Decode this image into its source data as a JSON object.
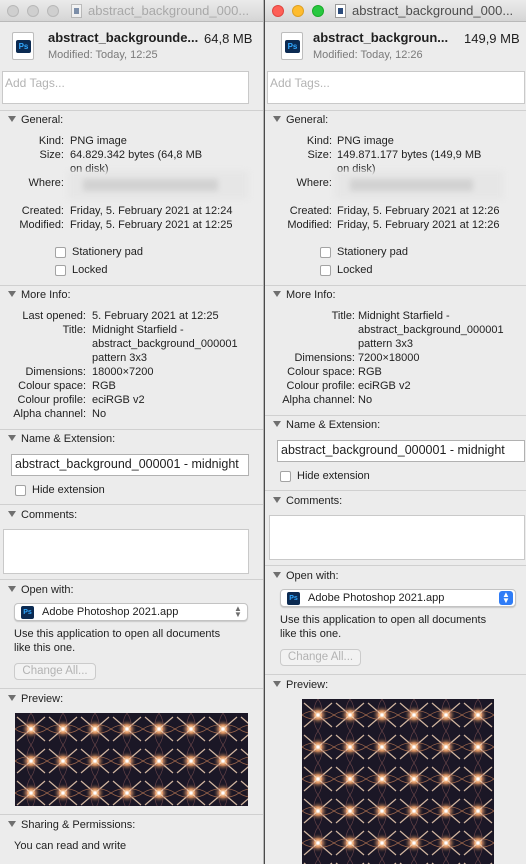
{
  "left_window": {
    "title": "abstract_background_000...",
    "file_name": "abstract_backgrounde...",
    "size_short": "64,8 MB",
    "modified_header": "Modified: Today, 12:25",
    "tags_placeholder": "Add Tags...",
    "general": {
      "header": "General:",
      "kind_label": "Kind:",
      "kind": "PNG image",
      "size_label": "Size:",
      "size_line1": "64.829.342 bytes (64,8 MB",
      "size_line2": "on disk)",
      "where_label": "Where:",
      "created_label": "Created:",
      "created": "Friday, 5. February 2021 at 12:24",
      "modified_label": "Modified:",
      "modified": "Friday, 5. February 2021 at 12:25",
      "stationery": "Stationery pad",
      "locked": "Locked"
    },
    "more_info": {
      "header": "More Info:",
      "last_opened_label": "Last opened:",
      "last_opened": "5. February 2021 at 12:25",
      "title_label": "Title:",
      "title_line1": "Midnight Starfield -",
      "title_line2": "abstract_background_000001",
      "title_line3": "pattern 3x3",
      "dimensions_label": "Dimensions:",
      "dimensions": "18000×7200",
      "colour_space_label": "Colour space:",
      "colour_space": "RGB",
      "colour_profile_label": "Colour profile:",
      "colour_profile": "eciRGB v2",
      "alpha_label": "Alpha channel:",
      "alpha": "No"
    },
    "name_ext": {
      "header": "Name & Extension:",
      "value": "abstract_background_000001 - midnight",
      "hide_ext": "Hide extension"
    },
    "comments_header": "Comments:",
    "open_with": {
      "header": "Open with:",
      "app": "Adobe Photoshop 2021.app",
      "desc_line1": "Use this application to open all documents",
      "desc_line2": "like this one.",
      "change_all": "Change All..."
    },
    "preview_header": "Preview:",
    "sharing": {
      "header": "Sharing & Permissions:",
      "text": "You can read and write"
    }
  },
  "right_window": {
    "title": "abstract_background_000...",
    "file_name": "abstract_backgroun...",
    "size_short": "149,9 MB",
    "modified_header": "Modified: Today, 12:26",
    "tags_placeholder": "Add Tags...",
    "general": {
      "header": "General:",
      "kind_label": "Kind:",
      "kind": "PNG image",
      "size_label": "Size:",
      "size_line1": "149.871.177 bytes (149,9 MB",
      "size_line2": "on disk)",
      "where_label": "Where:",
      "created_label": "Created:",
      "created": "Friday, 5. February 2021 at 12:26",
      "modified_label": "Modified:",
      "modified": "Friday, 5. February 2021 at 12:26",
      "stationery": "Stationery pad",
      "locked": "Locked"
    },
    "more_info": {
      "header": "More Info:",
      "title_label": "Title:",
      "title_line1": "Midnight Starfield -",
      "title_line2": "abstract_background_000001",
      "title_line3": "pattern 3x3",
      "dimensions_label": "Dimensions:",
      "dimensions": "7200×18000",
      "colour_space_label": "Colour space:",
      "colour_space": "RGB",
      "colour_profile_label": "Colour profile:",
      "colour_profile": "eciRGB v2",
      "alpha_label": "Alpha channel:",
      "alpha": "No"
    },
    "name_ext": {
      "header": "Name & Extension:",
      "value": "abstract_background_000001 - midnight",
      "hide_ext": "Hide extension"
    },
    "comments_header": "Comments:",
    "open_with": {
      "header": "Open with:",
      "app": "Adobe Photoshop 2021.app",
      "desc_line1": "Use this application to open all documents",
      "desc_line2": "like this one.",
      "change_all": "Change All..."
    },
    "preview_header": "Preview:"
  },
  "icons": {
    "file_type": "photoshop-file-icon",
    "app": "photoshop-app-icon",
    "disclosure": "disclosure-triangle-icon",
    "popup": "popup-arrows-icon"
  },
  "colors": {
    "window_bg": "#ececec",
    "accent": "#2f7cf6",
    "close": "#fe5f57",
    "minimize": "#febc2e",
    "zoom": "#28c840",
    "ps_blue": "#31a8ff",
    "ps_dark": "#0b2a52"
  }
}
